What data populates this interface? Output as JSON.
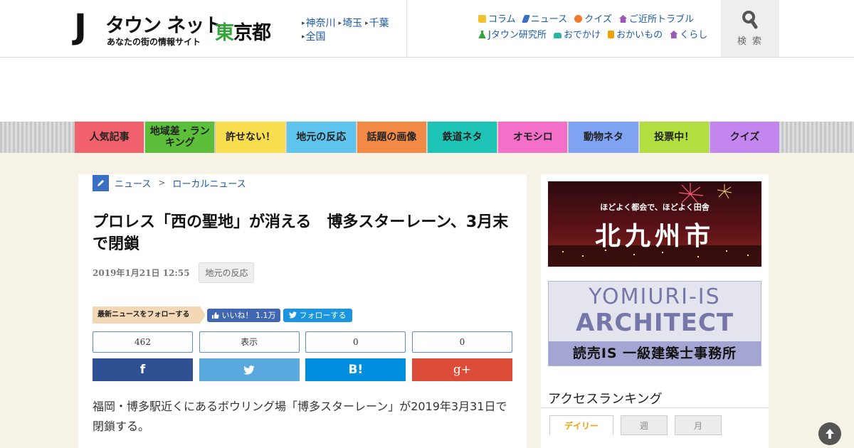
{
  "header": {
    "logo_main": "タウン ネット",
    "logo_j": "J",
    "logo_sub": "あなたの街の情報サイト",
    "pref_1": "東",
    "pref_2": "京都",
    "regions": [
      "神奈川",
      "埼玉",
      "千葉",
      "全国"
    ],
    "categories_row1": [
      {
        "label": "コラム",
        "icon": "notebook-icon",
        "color": "#f2c12e"
      },
      {
        "label": "ニュース",
        "icon": "pencil-icon",
        "color": "#3a6fc6"
      },
      {
        "label": "クイズ",
        "icon": "quiz-icon",
        "color": "#f07a2a"
      },
      {
        "label": "ご近所トラブル",
        "icon": "house-icon",
        "color": "#9b59b6"
      }
    ],
    "categories_row2": [
      {
        "label": "Jタウン研究所",
        "icon": "flask-icon",
        "color": "#35a43a"
      },
      {
        "label": "おでかけ",
        "icon": "car-icon",
        "color": "#2bb5a0"
      },
      {
        "label": "おかいもの",
        "icon": "bag-icon",
        "color": "#f0a000"
      },
      {
        "label": "くらし",
        "icon": "home-icon",
        "color": "#9b59b6"
      }
    ],
    "search_label": "検 索"
  },
  "nav": [
    {
      "label": "人気記事",
      "color": "#f0616b"
    },
    {
      "label": "地域差・ランキング",
      "color": "#5cbf3a"
    },
    {
      "label": "許せない！",
      "color": "#f9df4f"
    },
    {
      "label": "地元の反応",
      "color": "#5fc5ee"
    },
    {
      "label": "話題の画像",
      "color": "#f28a46"
    },
    {
      "label": "鉄道ネタ",
      "color": "#1ec4b5"
    },
    {
      "label": "オモシロ",
      "color": "#f470c8"
    },
    {
      "label": "動物ネタ",
      "color": "#7fa3f2"
    },
    {
      "label": "投票中！",
      "color": "#b2de3f"
    },
    {
      "label": "クイズ",
      "color": "#c385ee"
    }
  ],
  "article": {
    "breadcrumb": [
      "ニュース",
      "ローカルニュース"
    ],
    "breadcrumb_sep": ">",
    "title": "プロレス「西の聖地」が消える　博多スターレーン、3月末で閉鎖",
    "date": "2019年1月21日 12:55",
    "tag": "地元の反応",
    "follow_label": "最新ニュースをフォローする",
    "fb_like": "いいね！ 1.1万",
    "tw_follow": "フォローする",
    "share": [
      {
        "count": "462",
        "service": "facebook",
        "glyph": "f",
        "color": "#2d5192"
      },
      {
        "count": "表示",
        "service": "twitter",
        "glyph": "",
        "color": "#5aa9de"
      },
      {
        "count": "0",
        "service": "hatena",
        "glyph": "B!",
        "color": "#008fde"
      },
      {
        "count": "0",
        "service": "google-plus",
        "glyph": "g+",
        "color": "#dd4b39"
      }
    ],
    "lead": "福岡・博多駅近くにあるボウリング場「博多スターレーン」が2019年3月31日で閉鎖する。"
  },
  "sidebar": {
    "banner1_tagline": "ほどよく都会で、ほどよく田舎",
    "banner1_city": "北九州市",
    "banner2_line1": "YOMIURI-IS",
    "banner2_line2": "ARCHITECT",
    "banner2_line3": "読売IS 一級建築士事務所",
    "ranking_title": "アクセスランキング",
    "ranking_tabs": [
      "デイリー",
      "週",
      "月"
    ]
  }
}
